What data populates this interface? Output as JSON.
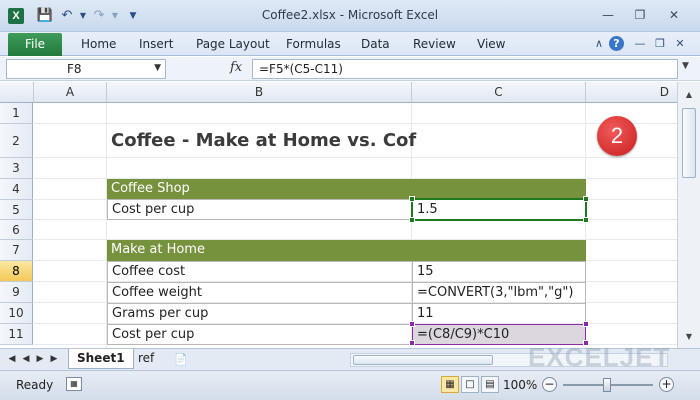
{
  "titlebar": {
    "app_icon_text": "X",
    "title": "Coffee2.xlsx - Microsoft Excel",
    "quick_access": [
      "save-icon",
      "undo-icon",
      "redo-icon",
      "customize-icon"
    ],
    "window_buttons": [
      "minimize-icon",
      "restore-icon",
      "close-icon"
    ]
  },
  "ribbon": {
    "file_label": "File",
    "tabs": [
      "Home",
      "Insert",
      "Page Layout",
      "Formulas",
      "Data",
      "Review",
      "View"
    ],
    "help_label": "?"
  },
  "formula_bar": {
    "name_box": "F8",
    "fx_label": "fx",
    "formula": "=F5*(C5-C11)"
  },
  "columns": [
    "A",
    "B",
    "C",
    "D"
  ],
  "rows": [
    "1",
    "2",
    "3",
    "4",
    "5",
    "6",
    "7",
    "8",
    "9",
    "10",
    "11"
  ],
  "sheet": {
    "title": "Coffee - Make at Home vs. Cof",
    "coffee_shop_header": "Coffee Shop",
    "cost_per_cup_label": "Cost per cup",
    "cost_per_cup_shop": "1.5",
    "make_at_home_header": "Make at Home",
    "coffee_cost_label": "Coffee cost",
    "coffee_cost_value": "15",
    "coffee_weight_label": "Coffee weight",
    "coffee_weight_value": "=CONVERT(3,\"lbm\",\"g\")",
    "grams_per_cup_label": "Grams per cup",
    "grams_per_cup_value": "11",
    "cost_per_cup_home_label": "Cost per cup",
    "cost_per_cup_home_value": "=(C8/C9)*C10"
  },
  "badge": "2",
  "sheet_tabs": [
    "Sheet1",
    "ref"
  ],
  "watermark": "EXCELJET",
  "status": {
    "ready": "Ready",
    "zoom": "100%",
    "zoom_minus": "−",
    "zoom_plus": "+"
  }
}
